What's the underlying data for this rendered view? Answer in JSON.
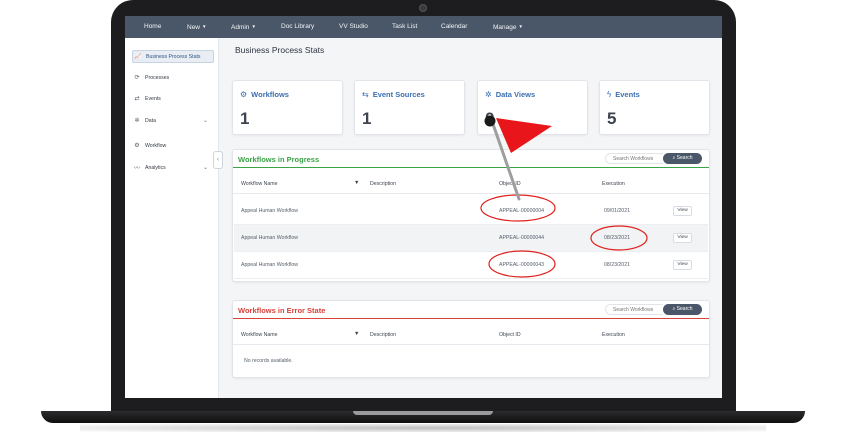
{
  "nav": {
    "items": [
      {
        "label": "Home",
        "dropdown": false
      },
      {
        "label": "New",
        "dropdown": true
      },
      {
        "label": "Admin",
        "dropdown": true
      },
      {
        "label": "Doc Library",
        "dropdown": false
      },
      {
        "label": "VV Studio",
        "dropdown": false
      },
      {
        "label": "Task List",
        "dropdown": false
      },
      {
        "label": "Calendar",
        "dropdown": false
      },
      {
        "label": "Manage",
        "dropdown": true
      }
    ]
  },
  "sidebar": {
    "items": [
      {
        "label": "Business Process Stats",
        "icon": "line-chart-icon",
        "glyph": "📈",
        "active": true
      },
      {
        "label": "Processes",
        "icon": "process-icon",
        "glyph": "⟳"
      },
      {
        "label": "Events",
        "icon": "events-icon",
        "glyph": "⇄"
      },
      {
        "label": "Data",
        "icon": "data-icon",
        "glyph": "✲",
        "expandable": true
      },
      {
        "label": "Workflow",
        "icon": "workflow-icon",
        "glyph": "⚙"
      },
      {
        "label": "Analytics",
        "icon": "analytics-icon",
        "glyph": "〰",
        "expandable": true
      }
    ],
    "collapse_glyph": "‹",
    "expand_glyph": "⌄"
  },
  "page": {
    "title": "Business Process Stats"
  },
  "stats": [
    {
      "label": "Workflows",
      "value": "1",
      "icon": "workflows-icon",
      "glyph": "⚙"
    },
    {
      "label": "Event Sources",
      "value": "1",
      "icon": "event-sources-icon",
      "glyph": "⇆"
    },
    {
      "label": "Data Views",
      "value": "0",
      "icon": "data-views-icon",
      "glyph": "✲"
    },
    {
      "label": "Events",
      "value": "5",
      "icon": "lightning-icon",
      "glyph": "ϟ"
    }
  ],
  "in_progress": {
    "title": "Workflows in Progress",
    "title_color": "#3aa346",
    "search_placeholder": "Search Workflows",
    "search_label": "Search",
    "columns": [
      "Workflow Name",
      "Description",
      "Object ID",
      "Execution"
    ],
    "sort_glyph": "▼",
    "rows": [
      {
        "name": "Appeal Human Workflow",
        "description": "",
        "object_id": "APPEAL-00000004",
        "execution": "09/01/2021",
        "action": "View"
      },
      {
        "name": "Appeal Human Workflow",
        "description": "",
        "object_id": "APPEAL-00000044",
        "execution": "08/23/2021",
        "action": "View"
      },
      {
        "name": "Appeal Human Workflow",
        "description": "",
        "object_id": "APPEAL-00000043",
        "execution": "08/23/2021",
        "action": "View"
      }
    ]
  },
  "error_state": {
    "title": "Workflows in Error State",
    "title_color": "#d9413a",
    "search_placeholder": "Search Workflows",
    "search_label": "Search",
    "columns": [
      "Workflow Name",
      "Description",
      "Object ID",
      "Execution"
    ],
    "sort_glyph": "▼",
    "empty_text": "No records available."
  },
  "colors": {
    "nav_bg": "#4a5768",
    "accent_blue": "#3b6fb0",
    "annotation_red": "#e0201b"
  }
}
